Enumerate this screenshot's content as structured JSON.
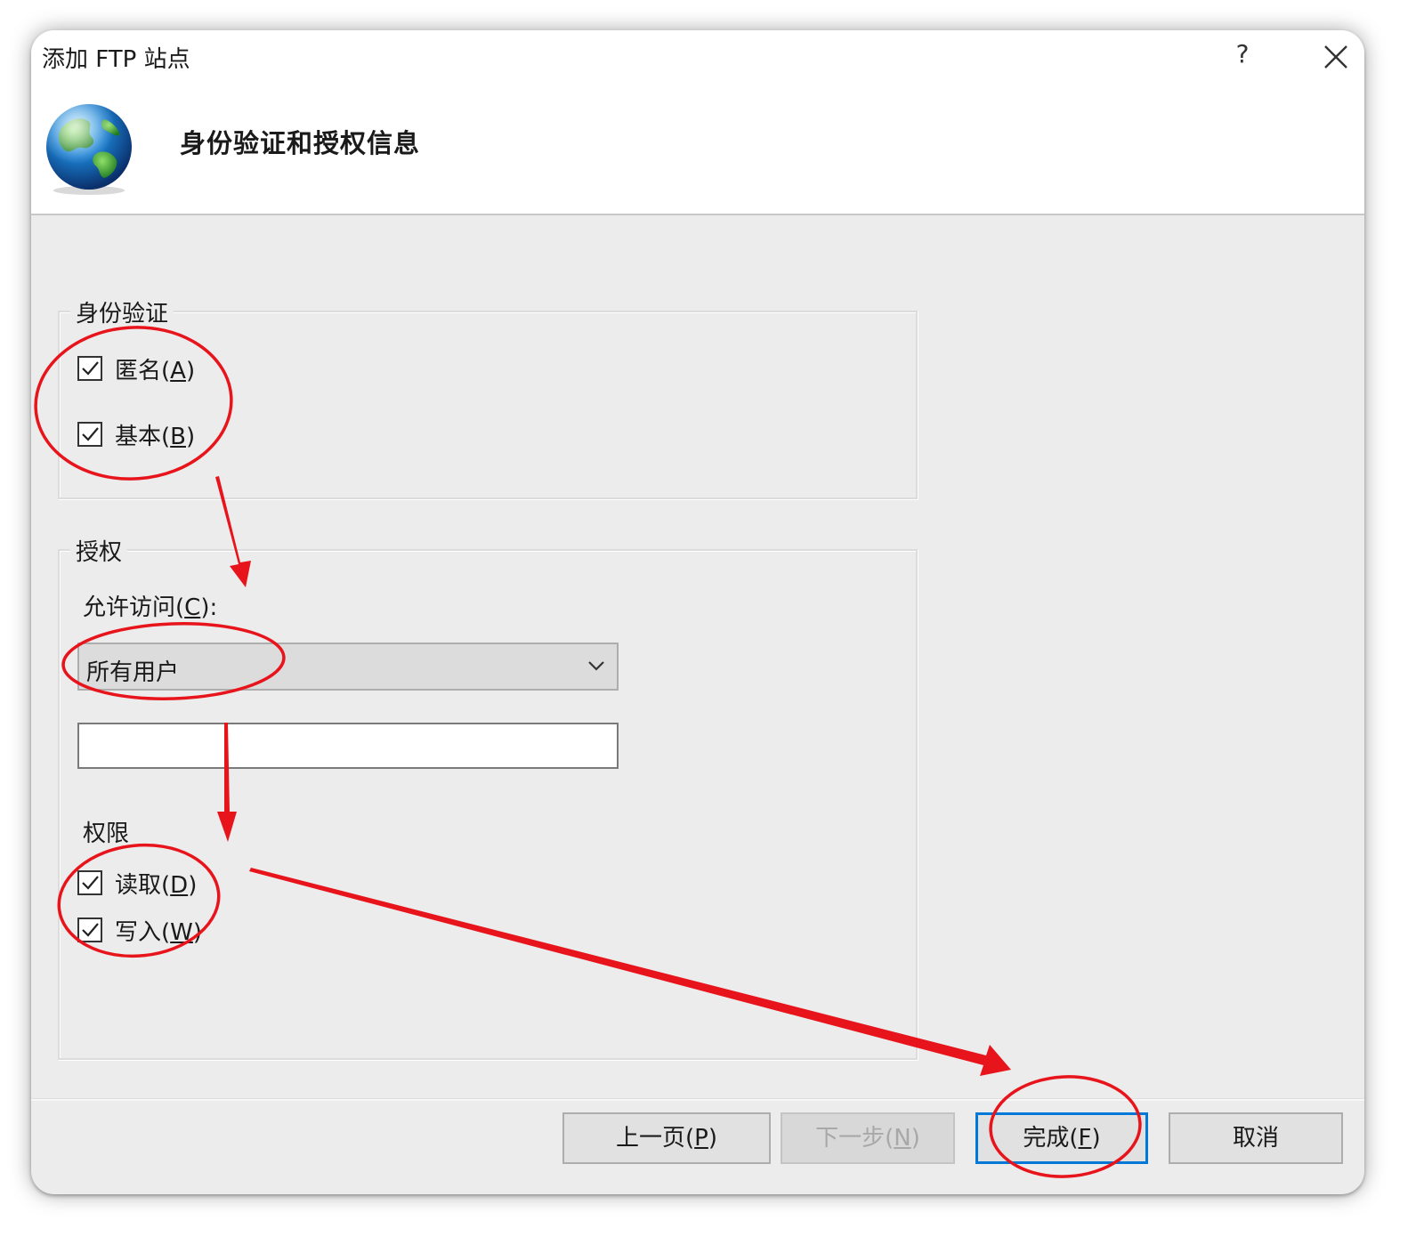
{
  "window": {
    "title": "添加 FTP 站点",
    "help_label": "?",
    "close_icon": "close-icon"
  },
  "header": {
    "heading": "身份验证和授权信息",
    "icon": "globe-icon"
  },
  "authentication": {
    "group_title": "身份验证",
    "anonymous": {
      "label": "匿名(",
      "mnemonic": "A",
      "suffix": ")",
      "checked": true
    },
    "basic": {
      "label": "基本(",
      "mnemonic": "B",
      "suffix": ")",
      "checked": true
    }
  },
  "authorization": {
    "group_title": "授权",
    "allow_access_label": "允许访问(",
    "allow_access_mnemonic": "C",
    "allow_access_suffix": "):",
    "allow_access_value": "所有用户",
    "user_textbox_value": "",
    "permissions_label": "权限",
    "read": {
      "label": "读取(",
      "mnemonic": "D",
      "suffix": ")",
      "checked": true
    },
    "write": {
      "label": "写入(",
      "mnemonic": "W",
      "suffix": ")",
      "checked": true
    }
  },
  "footer": {
    "previous": {
      "label": "上一页(",
      "mnemonic": "P",
      "suffix": ")"
    },
    "next": {
      "label": "下一步(",
      "mnemonic": "N",
      "suffix": ")",
      "disabled": true
    },
    "finish": {
      "label": "完成(",
      "mnemonic": "F",
      "suffix": ")"
    },
    "cancel": {
      "label": "取消"
    }
  },
  "annotations": {
    "color": "#e8141c"
  },
  "colors": {
    "dialog_bg": "#ececec",
    "header_bg": "#ffffff",
    "default_button_border": "#0078d7"
  }
}
